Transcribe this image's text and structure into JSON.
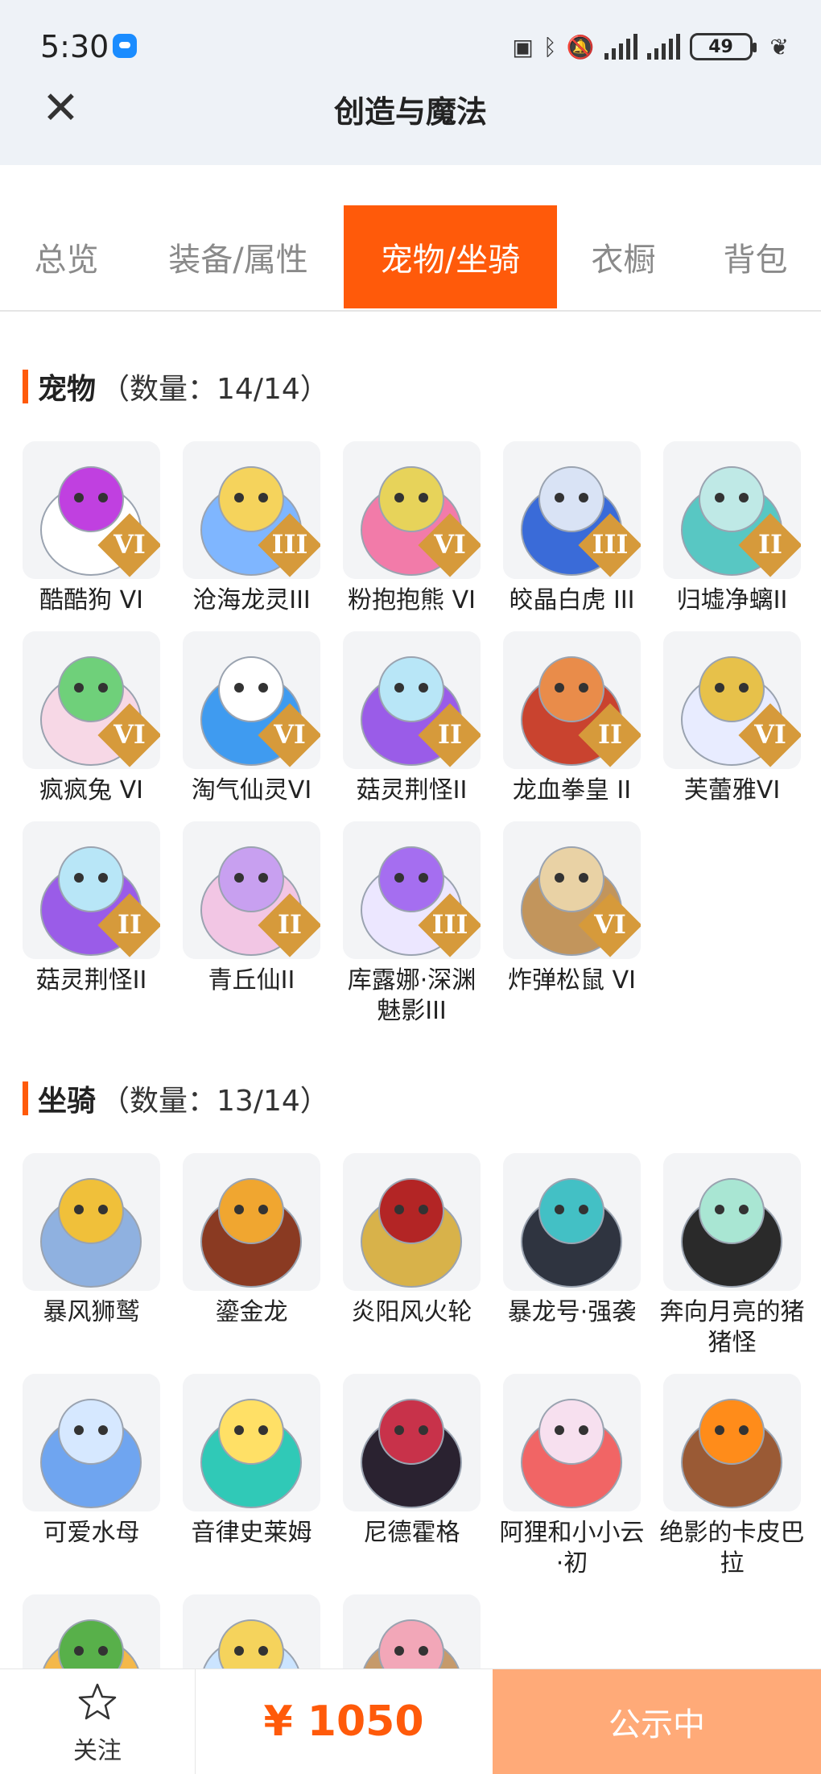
{
  "status_bar": {
    "time": "5:30",
    "battery": "49"
  },
  "header": {
    "title": "创造与魔法",
    "close_icon": "close-icon"
  },
  "tabs": [
    {
      "label": "总览"
    },
    {
      "label": "装备/属性"
    },
    {
      "label": "宠物/坐骑"
    },
    {
      "label": "衣橱"
    },
    {
      "label": "背包"
    }
  ],
  "active_tab": "宠物/坐骑",
  "pets": {
    "title": "宠物",
    "count": "（数量：14/14）",
    "items": [
      {
        "name": "酷酷狗 VI",
        "rank": "VI",
        "color": "#ffffff",
        "accent": "#c040e0"
      },
      {
        "name": "沧海龙灵III",
        "rank": "III",
        "color": "#7fb6ff",
        "accent": "#f5d35c"
      },
      {
        "name": "粉抱抱熊 VI",
        "rank": "VI",
        "color": "#f27ba9",
        "accent": "#e7d35a"
      },
      {
        "name": "皎晶白虎 III",
        "rank": "III",
        "color": "#3a6bd8",
        "accent": "#d9e3f5"
      },
      {
        "name": "归墟净螭II",
        "rank": "II",
        "color": "#58c7c3",
        "accent": "#bfe9e6"
      },
      {
        "name": "疯疯兔 VI",
        "rank": "VI",
        "color": "#f7d8e6",
        "accent": "#6fd07a"
      },
      {
        "name": "淘气仙灵VI",
        "rank": "VI",
        "color": "#3f9bf0",
        "accent": "#ffffff"
      },
      {
        "name": "菇灵荆怪II",
        "rank": "II",
        "color": "#9a5ce8",
        "accent": "#b8e6f7"
      },
      {
        "name": "龙血拳皇 II",
        "rank": "II",
        "color": "#c9432f",
        "accent": "#e98c4a"
      },
      {
        "name": "芙蕾雅VI",
        "rank": "VI",
        "color": "#e8ecff",
        "accent": "#e7c14a"
      },
      {
        "name": "菇灵荆怪II",
        "rank": "II",
        "color": "#9a5ce8",
        "accent": "#b8e6f7"
      },
      {
        "name": "青丘仙II",
        "rank": "II",
        "color": "#f2c6e4",
        "accent": "#c8a0f0"
      },
      {
        "name": "库露娜·深渊魅影III",
        "rank": "III",
        "color": "#ece7ff",
        "accent": "#a56ef0"
      },
      {
        "name": "炸弹松鼠 VI",
        "rank": "VI",
        "color": "#c2955c",
        "accent": "#e9d2a5"
      }
    ]
  },
  "mounts": {
    "title": "坐骑",
    "count": "（数量：13/14）",
    "items": [
      {
        "name": "暴风狮鹫",
        "color": "#8fb1e0",
        "accent": "#f0c03a"
      },
      {
        "name": "鎏金龙",
        "color": "#8a3a22",
        "accent": "#f0a630"
      },
      {
        "name": "炎阳风火轮",
        "color": "#d8b24a",
        "accent": "#b32525"
      },
      {
        "name": "暴龙号·强袭",
        "color": "#2f3440",
        "accent": "#43c0c5"
      },
      {
        "name": "奔向月亮的猪猪怪",
        "color": "#2a2a2a",
        "accent": "#a9e6d3"
      },
      {
        "name": "可爱水母",
        "color": "#6fa5f0",
        "accent": "#d6e8ff"
      },
      {
        "name": "音律史莱姆",
        "color": "#30c9b7",
        "accent": "#ffe066"
      },
      {
        "name": "尼德霍格",
        "color": "#2a2230",
        "accent": "#c8324a"
      },
      {
        "name": "阿狸和小小云·初",
        "color": "#f16565",
        "accent": "#f7e0ef"
      },
      {
        "name": "绝影的卡皮巴拉",
        "color": "#9a5a35",
        "accent": "#ff8c1a"
      },
      {
        "name": "",
        "color": "#f4b84a",
        "accent": "#58b04a"
      },
      {
        "name": "",
        "color": "#cbe4ff",
        "accent": "#f5d35c"
      },
      {
        "name": "",
        "color": "#c69a6b",
        "accent": "#f2a7b8"
      }
    ]
  },
  "footer": {
    "follow_label": "关注",
    "price": "¥ 1050",
    "status_label": "公示中"
  }
}
